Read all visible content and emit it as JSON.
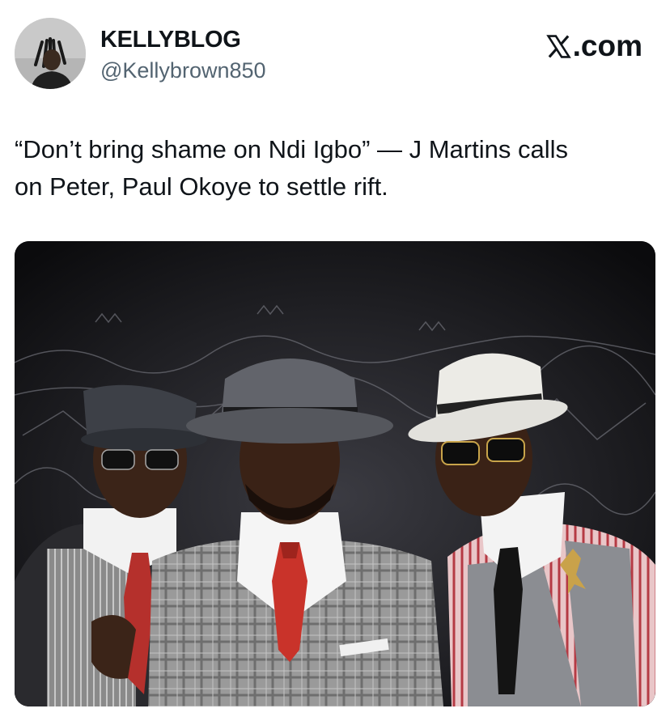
{
  "author": {
    "display_name": "KELLYBLOG",
    "handle": "@Kellybrown850",
    "avatar_icon": "profile-photo"
  },
  "source": {
    "logo_icon": "x-logo",
    "suffix": ".com"
  },
  "post": {
    "text_line1": "“Don’t bring shame on Ndi Igbo” — J Martins calls",
    "text_line2": "on Peter, Paul Okoye to settle rift."
  },
  "media": {
    "kind": "photo",
    "icon": "group-photo-three-men-in-hats"
  },
  "colors": {
    "text": "#0f1419",
    "secondary_text": "#536471",
    "background": "#ffffff"
  }
}
